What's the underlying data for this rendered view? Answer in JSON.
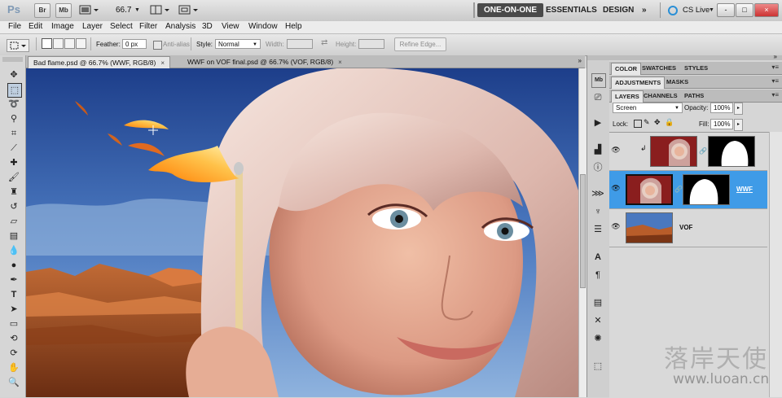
{
  "app": {
    "logo": "Ps",
    "zoom": "66.7",
    "bridge_label": "Br",
    "minibridge_label": "Mb",
    "workspaces": [
      "ONE-ON-ONE",
      "ESSENTIALS",
      "DESIGN"
    ],
    "more_workspaces": "»",
    "cs_live": "CS Live",
    "window_buttons": [
      "-",
      "□",
      "×"
    ]
  },
  "menu": [
    "File",
    "Edit",
    "Image",
    "Layer",
    "Select",
    "Filter",
    "Analysis",
    "3D",
    "View",
    "Window",
    "Help"
  ],
  "options": {
    "feather_label": "Feather:",
    "feather_value": "0 px",
    "antialias_label": "Anti-alias",
    "style_label": "Style:",
    "style_value": "Normal",
    "width_label": "Width:",
    "height_label": "Height:",
    "refine_edge": "Refine Edge..."
  },
  "tabs": [
    {
      "label": "Bad flame.psd @ 66.7% (WWF, RGB/8)",
      "active": true
    },
    {
      "label": "WWF on VOF final.psd @ 66.7% (VOF, RGB/8)",
      "active": false
    }
  ],
  "panels": {
    "group1": [
      "COLOR",
      "SWATCHES",
      "STYLES"
    ],
    "group2": [
      "ADJUSTMENTS",
      "MASKS"
    ],
    "group3": [
      "LAYERS",
      "CHANNELS",
      "PATHS"
    ],
    "blend_mode": "Screen",
    "opacity_label": "Opacity:",
    "opacity_value": "100%",
    "lock_label": "Lock:",
    "fill_label": "Fill:",
    "fill_value": "100%",
    "layers": [
      {
        "name": "",
        "selected": false,
        "type": "clipped"
      },
      {
        "name": "WWF",
        "selected": true,
        "type": "mask"
      },
      {
        "name": "VOF",
        "selected": false,
        "type": "plain"
      }
    ]
  },
  "watermark": {
    "chinese": "落岸天使",
    "url": "www.luoan.cn"
  },
  "icons": {
    "tools": [
      "move-icon",
      "marquee-icon",
      "lasso-icon",
      "quick-select-icon",
      "crop-icon",
      "eyedropper-icon",
      "healing-icon",
      "brush-icon",
      "clone-stamp-icon",
      "history-brush-icon",
      "eraser-icon",
      "gradient-icon",
      "blur-icon",
      "dodge-icon",
      "pen-icon",
      "type-icon",
      "path-select-icon",
      "shape-icon",
      "3d-rotate-icon",
      "3d-orbit-icon",
      "hand-icon",
      "zoom-icon"
    ],
    "dock": [
      "minibridge-icon",
      "history-icon",
      "actions-icon",
      "histogram-icon",
      "info-icon",
      "brushes-icon",
      "clone-source-icon",
      "tool-presets-icon",
      "character-icon",
      "paragraph-icon",
      "notes-icon",
      "3d-panel-icon",
      "animation-icon",
      "layer-comps-icon"
    ]
  },
  "colors": {
    "active_workspace_bg": "#4a4a4a",
    "layer_selected": "#3f9be7",
    "panel_bg": "#d6d6d6"
  }
}
